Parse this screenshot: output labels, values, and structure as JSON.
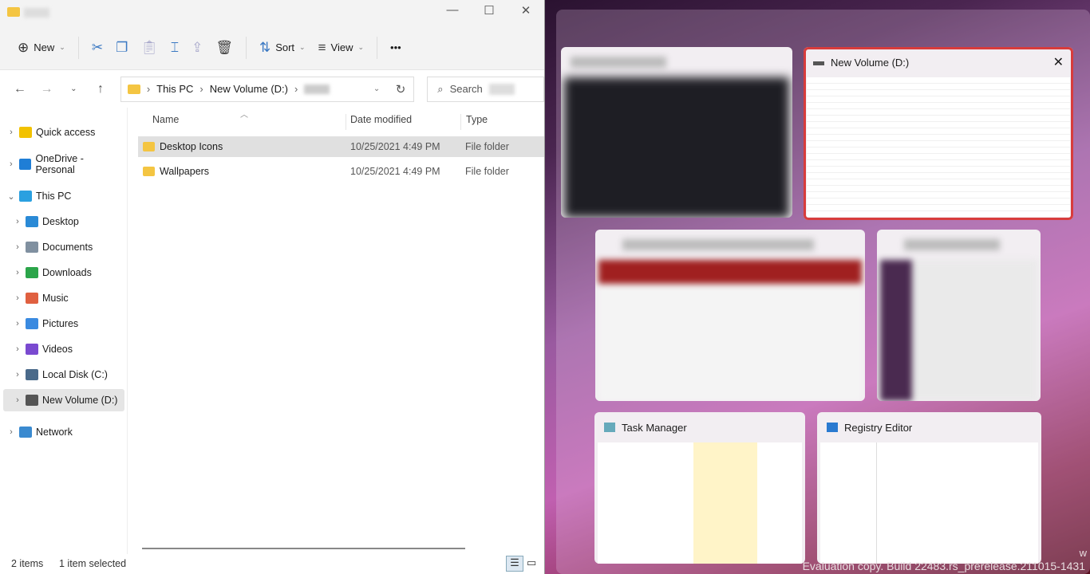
{
  "explorer": {
    "toolbar": {
      "new": "New",
      "sort": "Sort",
      "view": "View",
      "more": "•••"
    },
    "breadcrumb": [
      "This PC",
      "New Volume (D:)"
    ],
    "search_placeholder": "Search",
    "sidebar": [
      {
        "label": "Quick access",
        "color": "#f2c200",
        "expand": "›"
      },
      {
        "label": "OneDrive - Personal",
        "color": "#1f7ed6",
        "expand": "›"
      },
      {
        "label": "This PC",
        "color": "#2aa0e0",
        "expand": "⌄"
      },
      {
        "label": "Desktop",
        "color": "#2a8ad6",
        "expand": "›"
      },
      {
        "label": "Documents",
        "color": "#8090a0",
        "expand": "›"
      },
      {
        "label": "Downloads",
        "color": "#2ba54a",
        "expand": "›"
      },
      {
        "label": "Music",
        "color": "#e06040",
        "expand": "›"
      },
      {
        "label": "Pictures",
        "color": "#3a8ae0",
        "expand": "›"
      },
      {
        "label": "Videos",
        "color": "#7a4ad0",
        "expand": "›"
      },
      {
        "label": "Local Disk (C:)",
        "color": "#4a6a8a",
        "expand": "›"
      },
      {
        "label": "New Volume (D:)",
        "color": "#555555",
        "expand": "›"
      },
      {
        "label": "Network",
        "color": "#3a8ad0",
        "expand": "›"
      }
    ],
    "columns": {
      "name": "Name",
      "date": "Date modified",
      "type": "Type"
    },
    "files": [
      {
        "name": "Desktop Icons",
        "date": "10/25/2021 4:49 PM",
        "type": "File folder"
      },
      {
        "name": "Wallpapers",
        "date": "10/25/2021 4:49 PM",
        "type": "File folder"
      }
    ],
    "status": {
      "count": "2 items",
      "selected": "1 item selected"
    }
  },
  "snap": {
    "windows": [
      {
        "title": "New Volume (D:)",
        "close": "✕"
      },
      {
        "title": "Task Manager"
      },
      {
        "title": "Registry Editor"
      }
    ],
    "watermark": "Evaluation copy. Build 22483.rs_prerelease.211015-1431",
    "watermark_partial": "w"
  },
  "colors": {
    "accent": "#d83c3c"
  }
}
